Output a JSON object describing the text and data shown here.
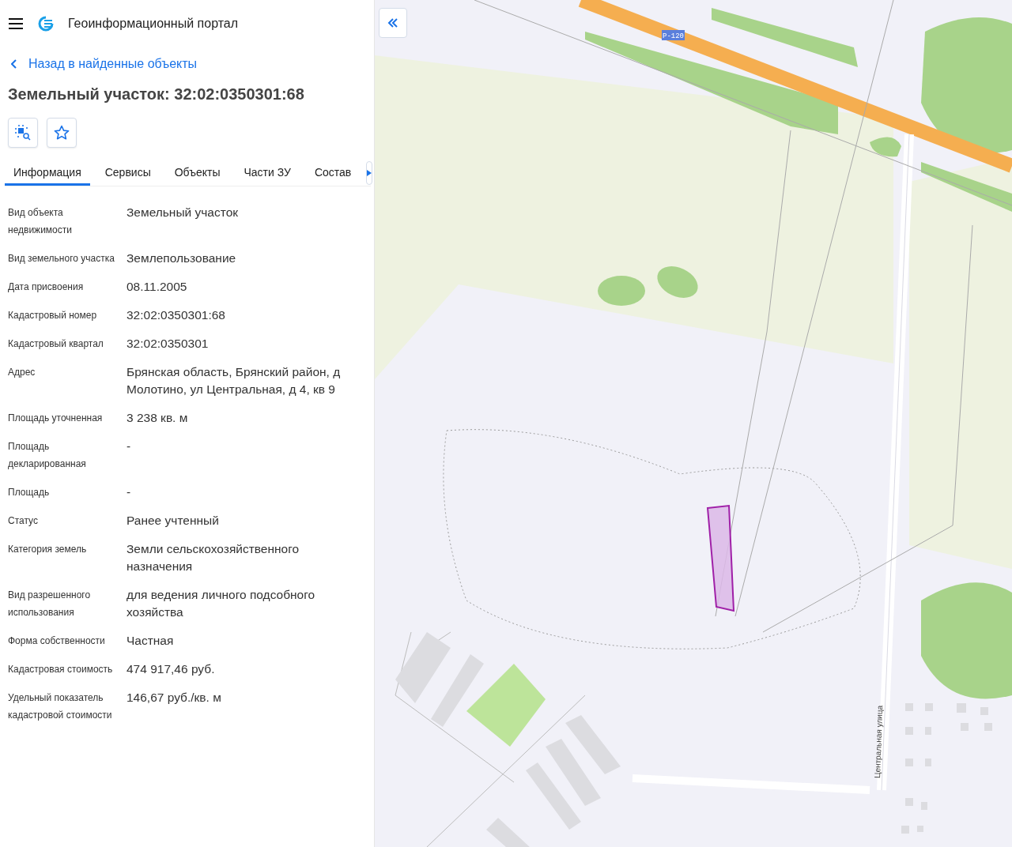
{
  "header": {
    "title": "Геоинформационный портал"
  },
  "back_link": "Назад в найденные объекты",
  "object_title": "Земельный участок: 32:02:0350301:68",
  "tabs": [
    {
      "label": "Информация",
      "selected": true
    },
    {
      "label": "Сервисы",
      "selected": false
    },
    {
      "label": "Объекты",
      "selected": false
    },
    {
      "label": "Части ЗУ",
      "selected": false
    },
    {
      "label": "Состав",
      "selected": false
    }
  ],
  "properties": [
    {
      "label": "Вид объекта недвижимости",
      "value": "Земельный участок"
    },
    {
      "label": "Вид земельного участка",
      "value": "Землепользование"
    },
    {
      "label": "Дата присвоения",
      "value": "08.11.2005"
    },
    {
      "label": "Кадастровый номер",
      "value": "32:02:0350301:68"
    },
    {
      "label": "Кадастровый квартал",
      "value": "32:02:0350301"
    },
    {
      "label": "Адрес",
      "value": "Брянская область, Брянский район, д Молотино, ул Центральная, д 4, кв 9"
    },
    {
      "label": "Площадь уточненная",
      "value": "3 238 кв. м"
    },
    {
      "label": "Площадь декларированная",
      "value": "-"
    },
    {
      "label": "Площадь",
      "value": "-"
    },
    {
      "label": "Статус",
      "value": "Ранее учтенный"
    },
    {
      "label": "Категория земель",
      "value": "Земли сельскохозяйственного назначения"
    },
    {
      "label": "Вид разрешенного использования",
      "value": "для ведения личного подсобного хозяйства"
    },
    {
      "label": "Форма собственности",
      "value": "Частная"
    },
    {
      "label": "Кадастровая стоимость",
      "value": "474 917,46 руб."
    },
    {
      "label": "Удельный показатель кадастровой стоимости",
      "value": "146,67 руб./кв. м"
    }
  ],
  "map": {
    "road_label": "Р-120",
    "street_label": "Центральная улица"
  }
}
